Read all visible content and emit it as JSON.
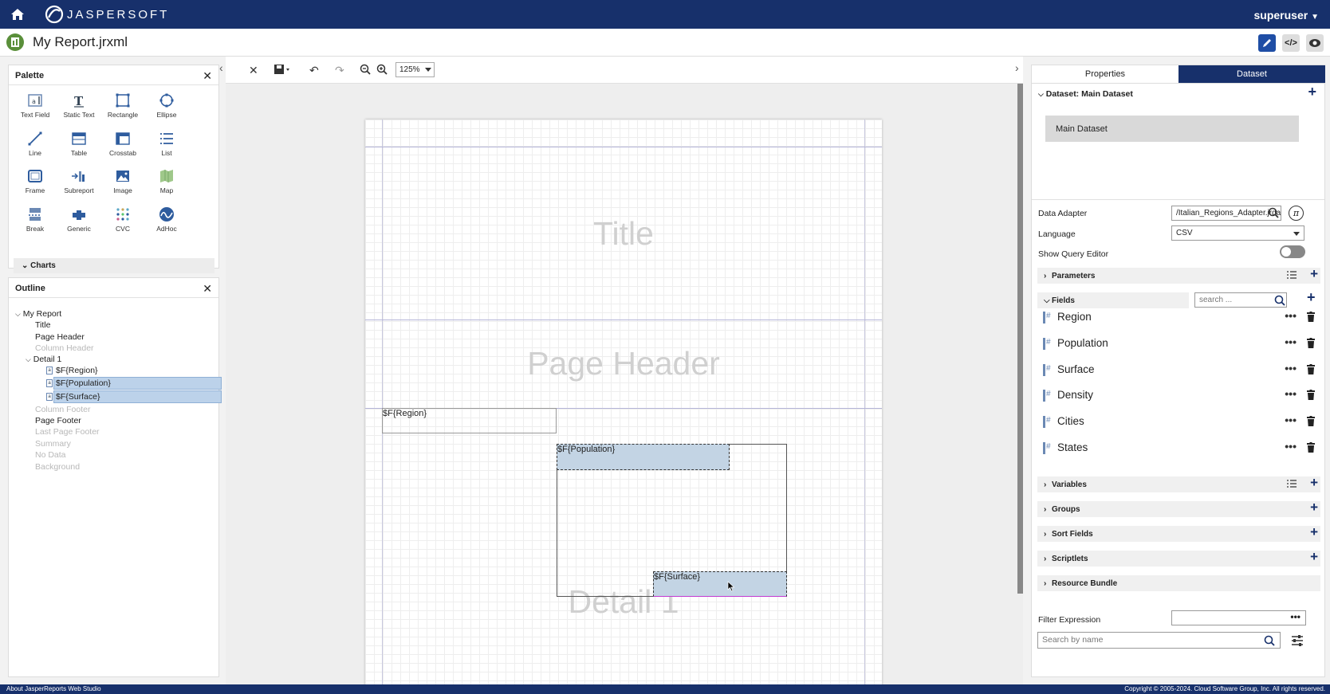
{
  "app": {
    "brand": "JASPERSOFT",
    "user": "superuser",
    "report_title": "My Report.jrxml"
  },
  "palette": {
    "title": "Palette",
    "items": [
      {
        "label": "Text Field",
        "icon": "text-field-icon"
      },
      {
        "label": "Static Text",
        "icon": "static-text-icon"
      },
      {
        "label": "Rectangle",
        "icon": "rectangle-icon"
      },
      {
        "label": "Ellipse",
        "icon": "ellipse-icon"
      },
      {
        "label": "Line",
        "icon": "line-icon"
      },
      {
        "label": "Table",
        "icon": "table-icon"
      },
      {
        "label": "Crosstab",
        "icon": "crosstab-icon"
      },
      {
        "label": "List",
        "icon": "list-icon"
      },
      {
        "label": "Frame",
        "icon": "frame-icon"
      },
      {
        "label": "Subreport",
        "icon": "subreport-icon"
      },
      {
        "label": "Image",
        "icon": "image-icon"
      },
      {
        "label": "Map",
        "icon": "map-icon"
      },
      {
        "label": "Break",
        "icon": "break-icon"
      },
      {
        "label": "Generic",
        "icon": "generic-icon"
      },
      {
        "label": "CVC",
        "icon": "cvc-icon"
      },
      {
        "label": "AdHoc",
        "icon": "adhoc-icon"
      }
    ],
    "charts_label": "Charts"
  },
  "outline": {
    "title": "Outline",
    "root": "My Report",
    "title_band": "Title",
    "page_header": "Page Header",
    "column_header": "Column Header",
    "detail": "Detail 1",
    "detail_items": [
      "$F{Region}",
      "$F{Population}",
      "$F{Surface}"
    ],
    "column_footer": "Column Footer",
    "page_footer": "Page Footer",
    "last_page_footer": "Last Page Footer",
    "summary": "Summary",
    "no_data": "No Data",
    "background": "Background"
  },
  "toolbar": {
    "zoom": "125%"
  },
  "canvas": {
    "bands": {
      "title": "Title",
      "page_header": "Page Header",
      "detail": "Detail 1"
    },
    "elements": {
      "region": "$F{Region}",
      "population": "$F{Population}",
      "surface": "$F{Surface}"
    }
  },
  "right": {
    "tabs": {
      "properties": "Properties",
      "dataset": "Dataset"
    },
    "dataset_header": "Dataset: Main Dataset",
    "dataset_item": "Main Dataset",
    "data_adapter_label": "Data Adapter",
    "data_adapter_value": "/Italian_Regions_Adapter.jrdax",
    "language_label": "Language",
    "language_value": "CSV",
    "query_editor_label": "Show Query Editor",
    "parameters": "Parameters",
    "fields": "Fields",
    "fields_search_placeholder": "search ...",
    "field_items": [
      "Region",
      "Population",
      "Surface",
      "Density",
      "Cities",
      "States"
    ],
    "variables": "Variables",
    "groups": "Groups",
    "sort_fields": "Sort Fields",
    "scriptlets": "Scriptlets",
    "resource_bundle": "Resource Bundle",
    "filter_expression_label": "Filter Expression",
    "search_by_name_placeholder": "Search by name"
  },
  "footer": {
    "about": "About JasperReports Web Studio",
    "copyright": "Copyright © 2005-2024. Cloud Software Group, Inc. All rights reserved."
  },
  "colors": {
    "navy": "#17306b",
    "selection": "#c3d4e4"
  }
}
